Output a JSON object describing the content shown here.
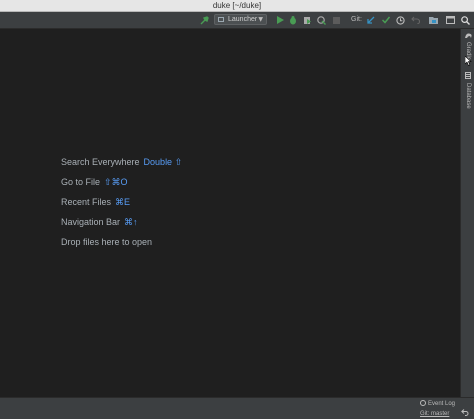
{
  "window": {
    "title": "duke [~/duke]"
  },
  "toolbar": {
    "run_config_label": "Launcher",
    "git_label": "Git:",
    "icons": [
      "hammer-icon",
      "run-icon",
      "debug-icon",
      "coverage-icon",
      "profile-icon",
      "stop-icon",
      "git-update-icon",
      "git-commit-icon",
      "git-history-icon",
      "git-revert-icon",
      "project-structure-icon",
      "presentation-icon",
      "search-icon"
    ]
  },
  "welcome": {
    "hints": [
      {
        "label": "Search Everywhere",
        "shortcut": "Double ⇧"
      },
      {
        "label": "Go to File",
        "shortcut": "⇧⌘O"
      },
      {
        "label": "Recent Files",
        "shortcut": "⌘E"
      },
      {
        "label": "Navigation Bar",
        "shortcut": "⌘↑"
      },
      {
        "label": "Drop files here to open",
        "shortcut": ""
      }
    ]
  },
  "right_strip": {
    "tabs": [
      {
        "label": "Gradle",
        "icon": "gradle-icon"
      },
      {
        "label": "Database",
        "icon": "database-icon"
      }
    ]
  },
  "status": {
    "event_log": "Event Log",
    "git_branch": "Git: master"
  },
  "colors": {
    "background": "#1f1f1f",
    "toolbar": "#3c3f41",
    "shortcut": "#589df6",
    "text": "#a9b0b6",
    "run_green": "#499c54",
    "git_blue": "#3592c4"
  }
}
